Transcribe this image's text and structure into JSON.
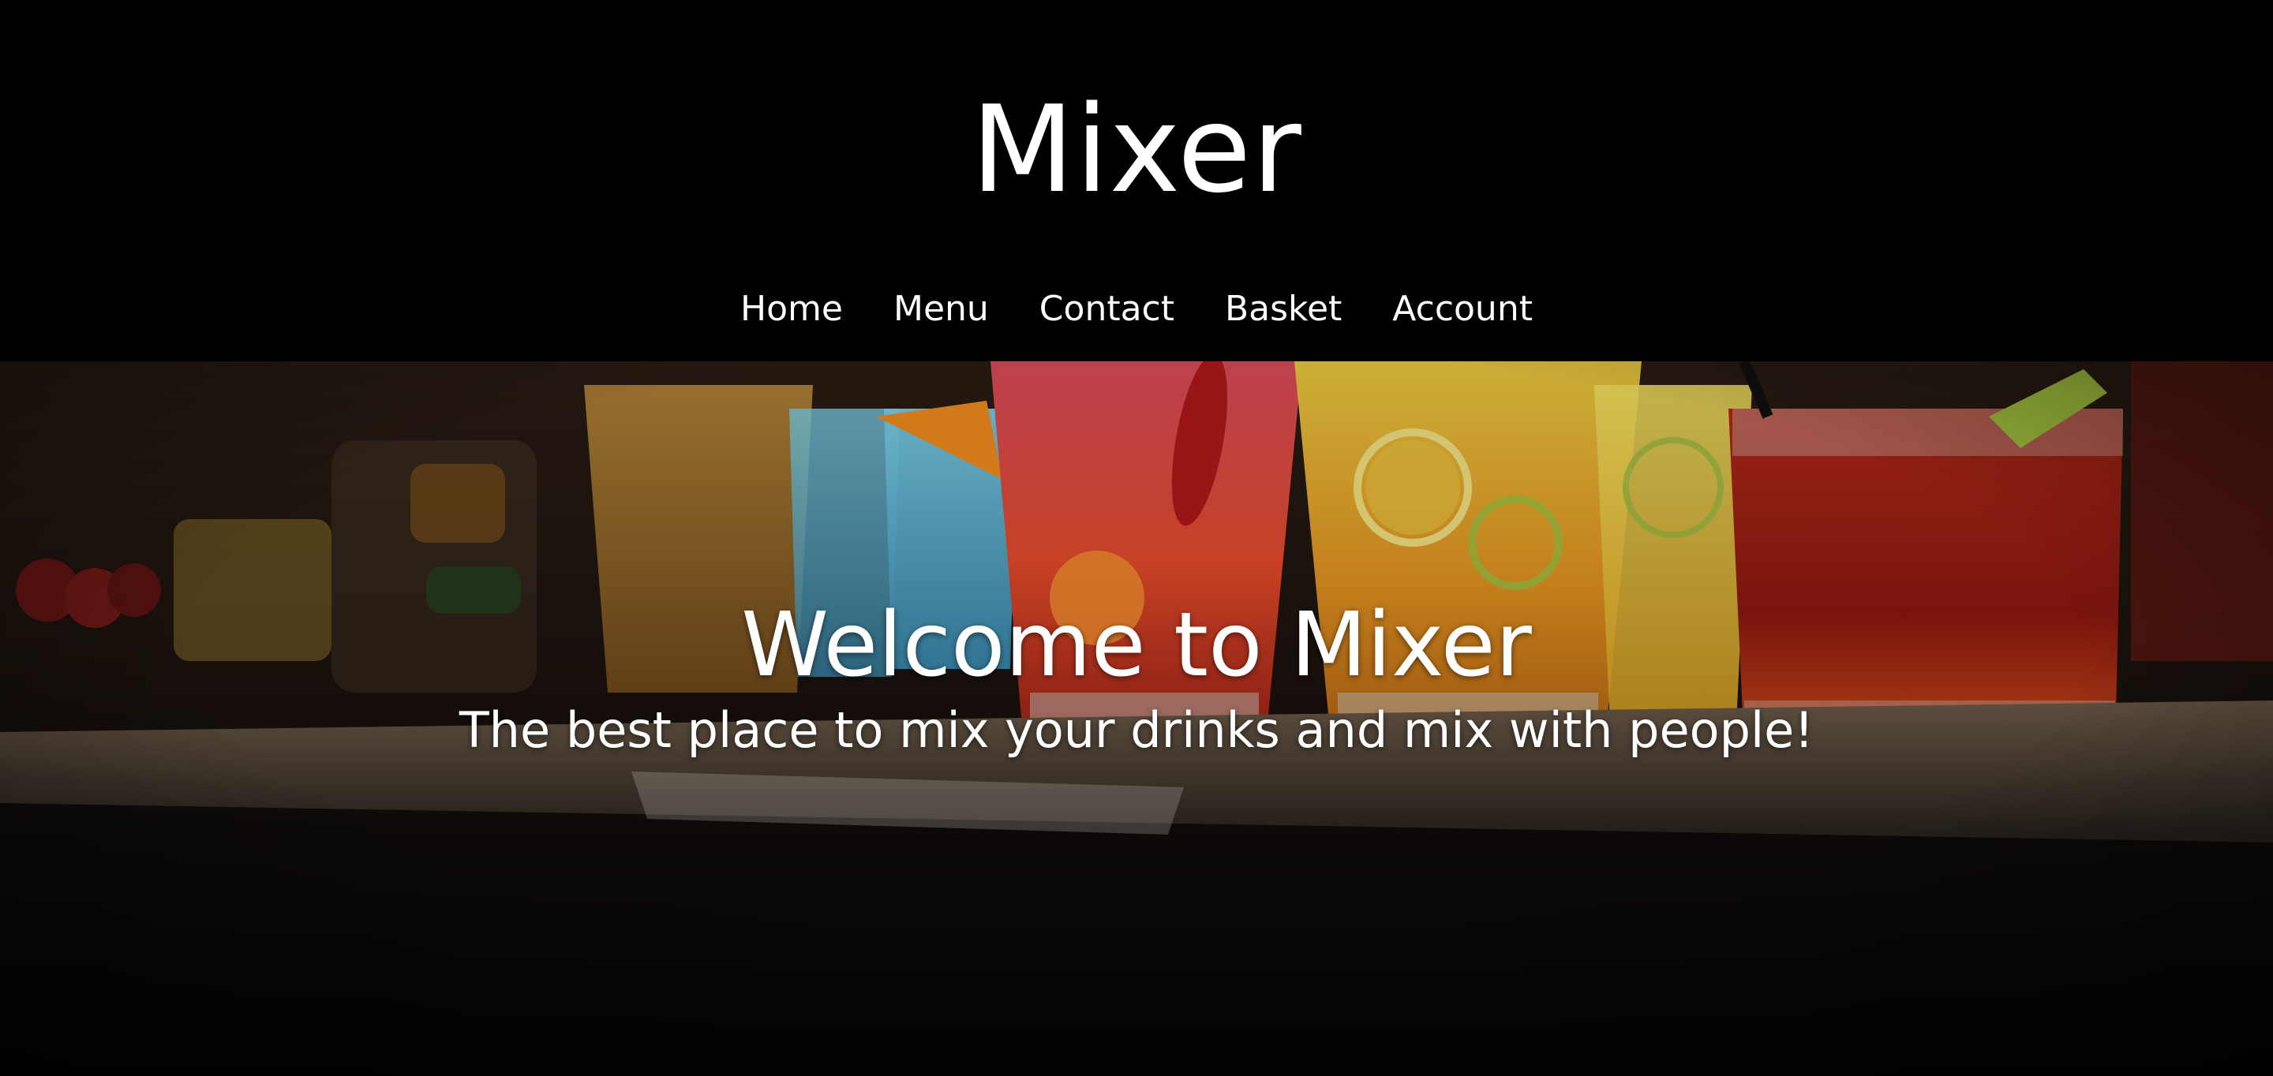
{
  "header": {
    "site_title": "Mixer",
    "nav": [
      {
        "label": "Home"
      },
      {
        "label": "Menu"
      },
      {
        "label": "Contact"
      },
      {
        "label": "Basket"
      },
      {
        "label": "Account"
      }
    ]
  },
  "hero": {
    "heading": "Welcome to Mixer",
    "subheading": "The best place to mix your drinks and mix with people!",
    "image_icon": "cocktail-bar-photo"
  },
  "colors": {
    "header_bg": "#000000",
    "text": "#ffffff"
  }
}
